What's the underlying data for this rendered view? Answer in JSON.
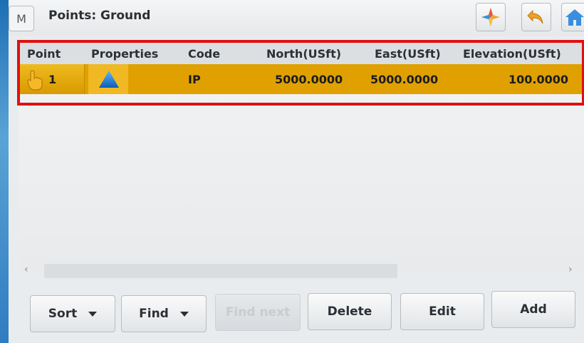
{
  "titlebar": {
    "menu_glyph": "M",
    "title": "Points: Ground",
    "icons": [
      "compass-star-icon",
      "undo-icon",
      "home-icon"
    ]
  },
  "table": {
    "columns": [
      "Point",
      "Properties",
      "Code",
      "North(USft)",
      "East(USft)",
      "Elevation(USft)"
    ],
    "rows": [
      {
        "icon": "hand-pointer-icon",
        "point": "1",
        "properties_icon": "triangle-point-icon",
        "code": "IP",
        "north": "5000.0000",
        "east": "5000.0000",
        "elevation": "100.0000",
        "selected": true
      }
    ]
  },
  "scroll": {
    "left_glyph": "‹",
    "right_glyph": "›"
  },
  "buttons": {
    "sort": "Sort",
    "find": "Find",
    "find_next": "Find next",
    "delete": "Delete",
    "edit": "Edit",
    "add": "Add"
  },
  "colors": {
    "selected_row": "#e0a100",
    "highlight_frame": "#e01010",
    "triangle": "#1f7fd4"
  }
}
